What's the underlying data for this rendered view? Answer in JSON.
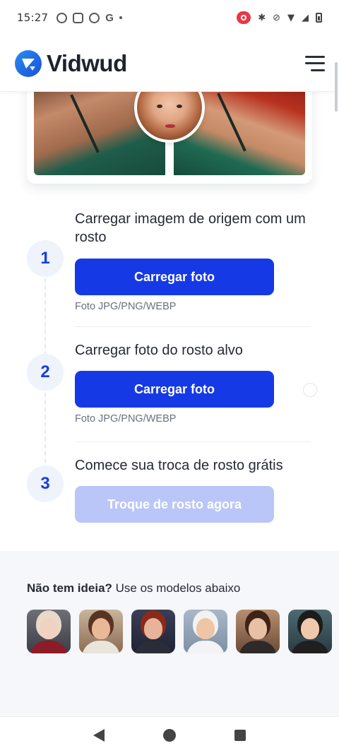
{
  "status_bar": {
    "time": "15:27",
    "left_icons": [
      "sync-icon",
      "instagram-icon",
      "sync-icon",
      "google-icon",
      "dot-icon"
    ],
    "google_letter": "G",
    "right_icons": [
      "screen-record-icon",
      "bluetooth-icon",
      "mute-icon",
      "wifi-icon",
      "signal-icon",
      "battery-icon"
    ]
  },
  "header": {
    "brand": "Vidwud",
    "brand_color": "#1f6fe0",
    "menu_icon": "hamburger-menu-icon"
  },
  "steps": [
    {
      "number": "1",
      "title": "Carregar imagem de origem com um rosto",
      "button": "Carregar foto",
      "hint": "Foto JPG/PNG/WEBP"
    },
    {
      "number": "2",
      "title": "Carregar foto do rosto alvo",
      "button": "Carregar foto",
      "hint": "Foto JPG/PNG/WEBP"
    },
    {
      "number": "3",
      "title": "Comece sua troca de rosto grátis",
      "button": "Troque de rosto agora"
    }
  ],
  "ideas": {
    "bold": "Não tem ideia?",
    "rest": " Use os modelos abaixo"
  },
  "colors": {
    "primary_button": "#1639e6",
    "disabled_button": "#b9c6f7",
    "step_number": "#1540dd"
  },
  "nav": {
    "back_icon": "back-triangle-icon",
    "home_icon": "home-circle-icon",
    "recent_icon": "recents-square-icon"
  }
}
